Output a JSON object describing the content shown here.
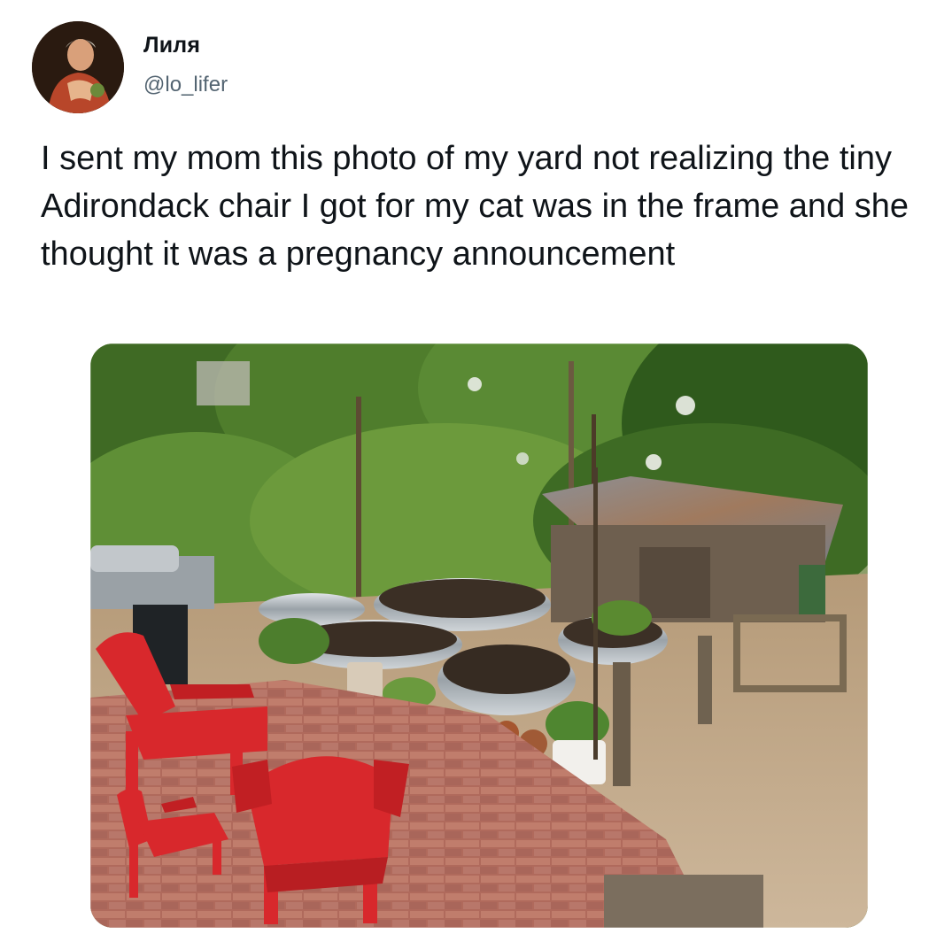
{
  "author": {
    "display_name": "Лиля",
    "handle": "@lo_lifer",
    "avatar_icon": "avatar-portrait-icon"
  },
  "tweet": {
    "text": "I sent my mom this photo of my yard not realizing the tiny Adirondack chair I got for my cat was in the frame and she thought it was a pregnancy announcement"
  },
  "photo": {
    "subject_icon": "backyard-photo"
  },
  "colors": {
    "text_primary": "#0f1419",
    "text_secondary": "#536471",
    "chair_red": "#d8282c"
  }
}
